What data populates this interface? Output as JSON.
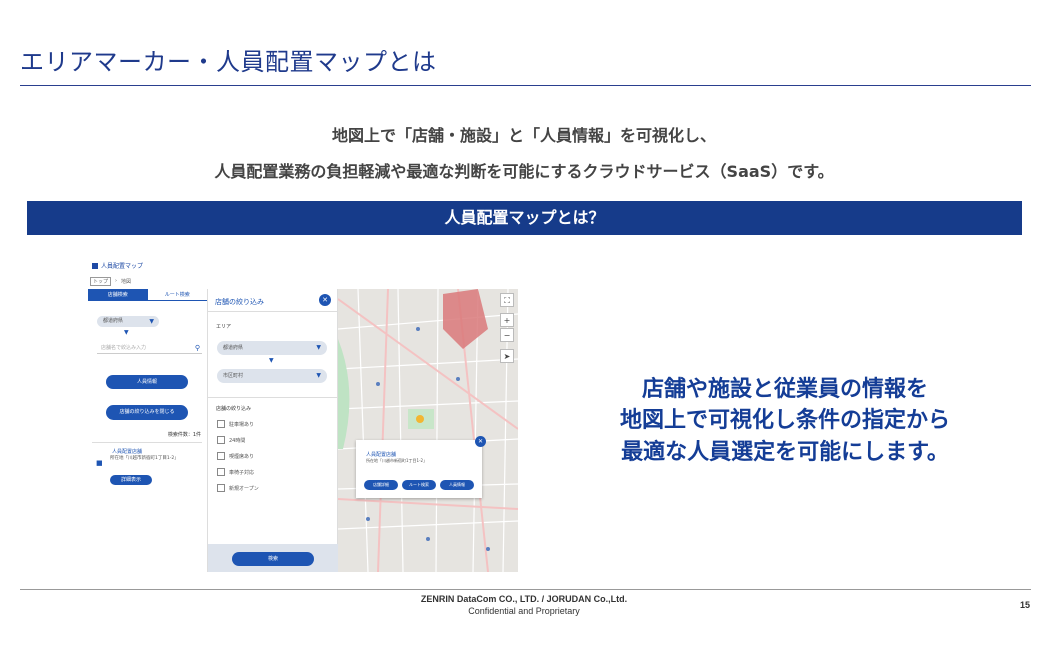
{
  "slide": {
    "title": "エリアマーカー・人員配置マップとは",
    "intro_line1": "地図上で「店舗・施設」と「人員情報」を可視化し、",
    "intro_line2": "人員配置業務の負担軽減や最適な判断を可能にするクラウドサービス（SaaS）です。",
    "banner": "人員配置マップとは？",
    "highlight_line1": "店舗や施設と従業員の情報を",
    "highlight_line2": "地図上で可視化し条件の指定から",
    "highlight_line3": "最適な人員選定を可能にします。",
    "footer_company": "ZENRIN DataCom CO., LTD. / JORUDAN Co.,Ltd.",
    "footer_confidential": "Confidential and Proprietary",
    "page_number": "15"
  },
  "app": {
    "header_title": "人員配置マップ",
    "breadcrumb": [
      "トップ",
      "地図"
    ],
    "left_panel": {
      "tabs": [
        "店舗検索",
        "ルート検索"
      ],
      "prefecture_select": "都道府県",
      "search_placeholder": "店舗名で絞込み入力",
      "staff_button": "人員情報",
      "filter_toggle_button": "店舗の絞り込みを閉じる",
      "result_count": "検索件数：1件",
      "result_item_title": "人員配置店舗",
      "result_item_address": "所在地「川越市新宿町1丁目1-2」",
      "result_item_button": "詳細表示"
    },
    "filter_panel": {
      "title": "店舗の絞り込み",
      "area_label": "エリア",
      "prefecture_select": "都道府県",
      "city_select": "市区町村",
      "conditions_label": "店舗の絞り込み",
      "checkboxes": [
        "駐車場あり",
        "24時間",
        "喫煙席あり",
        "車椅子対応",
        "新規オープン"
      ],
      "search_button": "検索"
    },
    "map_popup": {
      "title": "人員配置店舗",
      "address": "所在地「川越市新宿町1丁目1-2」",
      "buttons": [
        "店舗詳細",
        "ルート検索",
        "人員情報"
      ]
    },
    "map_controls": [
      "⛶",
      "+",
      "−",
      "➤"
    ]
  },
  "colors": {
    "title_blue": "#1f3a8c",
    "banner_blue": "#163b8a",
    "app_blue": "#1e55b3",
    "highlight_blue": "#143d96"
  }
}
